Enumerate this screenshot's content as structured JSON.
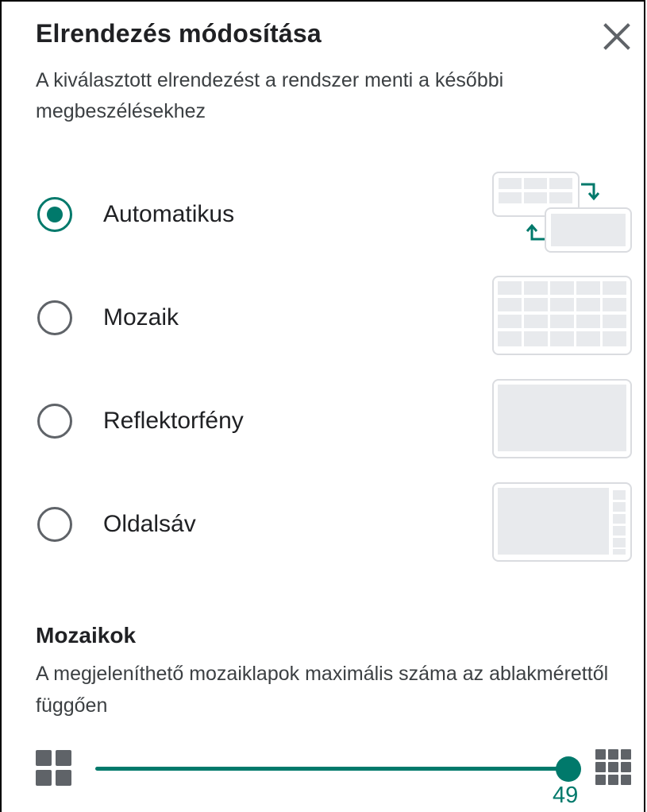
{
  "dialog": {
    "title": "Elrendezés módosítása",
    "subtitle": "A kiválasztott elrendezést a rendszer menti a későbbi megbeszélésekhez",
    "close_icon": "close-icon"
  },
  "layouts": {
    "options": [
      {
        "label": "Automatikus",
        "selected": true,
        "icon": "auto-layout-icon"
      },
      {
        "label": "Mozaik",
        "selected": false,
        "icon": "tiled-layout-icon"
      },
      {
        "label": "Reflektorfény",
        "selected": false,
        "icon": "spotlight-layout-icon"
      },
      {
        "label": "Oldalsáv",
        "selected": false,
        "icon": "sidebar-layout-icon"
      }
    ]
  },
  "tiles": {
    "title": "Mozaikok",
    "description": "A megjeleníthető mozaiklapok maximális száma az ablakmérettől függően",
    "slider_value": "49",
    "slider_fraction": 1.0,
    "min_icon": "grid-2x2-icon",
    "max_icon": "grid-3x3-icon"
  },
  "colors": {
    "accent": "#00796b",
    "thumb_border": "#dadce0",
    "thumb_fill": "#e8eaed",
    "text": "#202124"
  }
}
